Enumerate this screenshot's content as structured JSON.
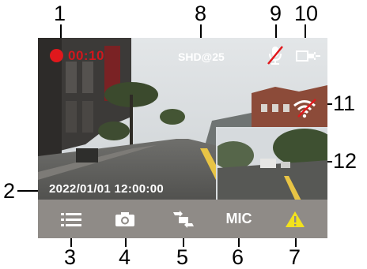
{
  "callouts": [
    "1",
    "2",
    "3",
    "4",
    "5",
    "6",
    "7",
    "8",
    "9",
    "10",
    "11",
    "12"
  ],
  "status": {
    "rec_time": "00:10",
    "resolution": "SHD@25",
    "timestamp": "2022/01/01  12:00:00"
  },
  "menu": {
    "mic_label": "MIC"
  },
  "colors": {
    "record": "#e0181c",
    "warning": "#f2e21c",
    "menubar": "#8f8b87"
  },
  "icons": [
    "record-dot-icon",
    "mic-muted-icon",
    "power-plug-icon",
    "wifi-off-icon",
    "menu-list-icon",
    "camera-icon",
    "rotate-swap-icon",
    "warning-icon"
  ]
}
